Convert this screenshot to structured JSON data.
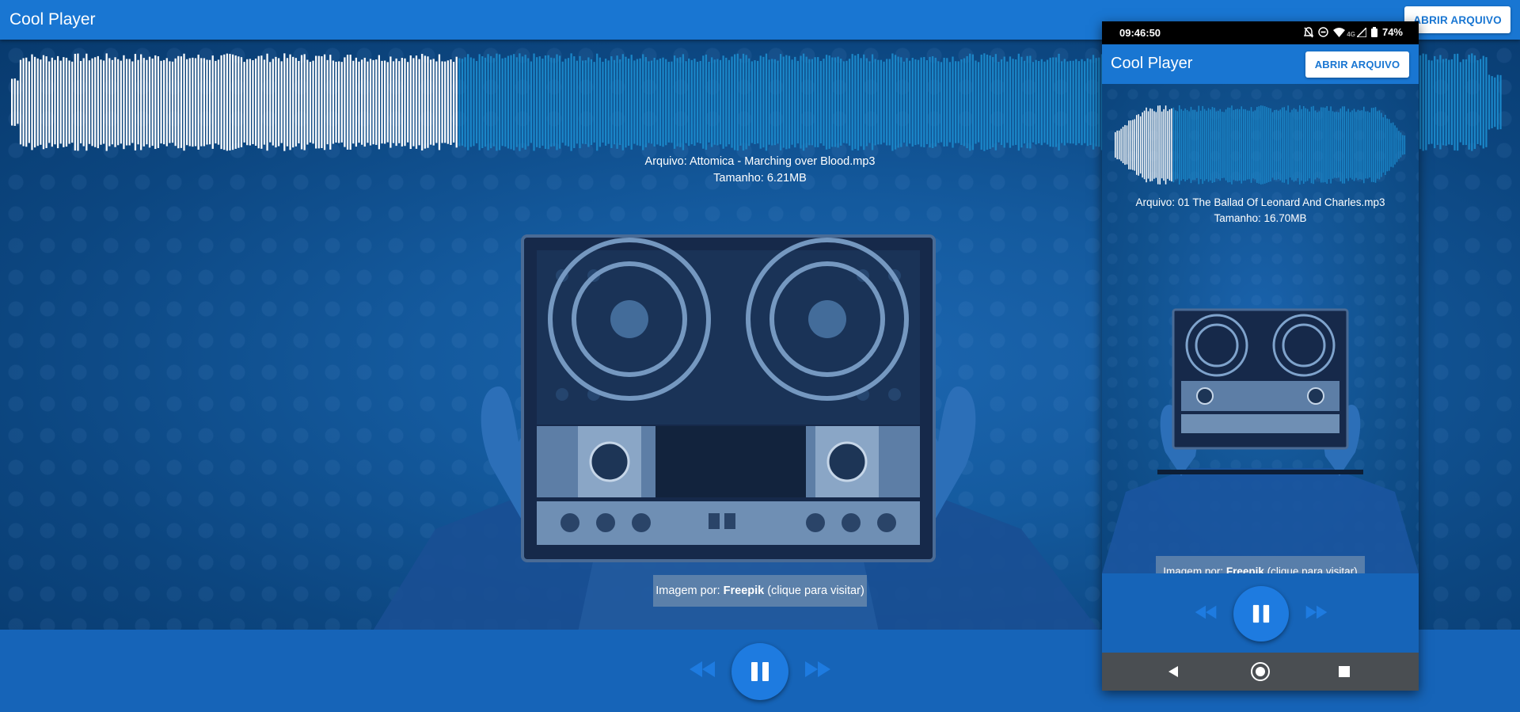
{
  "desktop": {
    "app_title": "Cool Player",
    "open_button": "ABRIR ARQUIVO",
    "file_label": "Arquivo: Attomica - Marching over Blood.mp3",
    "size_label": "Tamanho: 6.21MB",
    "playback_progress": 0.3,
    "credit": {
      "prefix": "Imagem por: ",
      "author": "Freepik",
      "suffix": " (clique para visitar)"
    },
    "controls": {
      "rewind_icon": "rewind-icon",
      "pause_icon": "pause-icon",
      "forward_icon": "fast-forward-icon"
    }
  },
  "phone": {
    "status_time": "09:46:50",
    "network_label": "4G",
    "battery_percent": "74%",
    "app_title": "Cool Player",
    "open_button": "ABRIR ARQUIVO",
    "file_label": "Arquivo: 01 The Ballad Of Leonard And Charles.mp3",
    "size_label": "Tamanho: 16.70MB",
    "playback_progress": 0.2,
    "credit": {
      "prefix": "Imagem por: ",
      "author": "Freepik",
      "suffix": " (clique para visitar)"
    },
    "nav": [
      "back-icon",
      "home-icon",
      "recents-icon"
    ]
  },
  "colors": {
    "primary": "#1976d2",
    "wave_played": "#ffffff",
    "wave_unplayed": "#1a86c8",
    "controls_bg": "#1664b8"
  }
}
